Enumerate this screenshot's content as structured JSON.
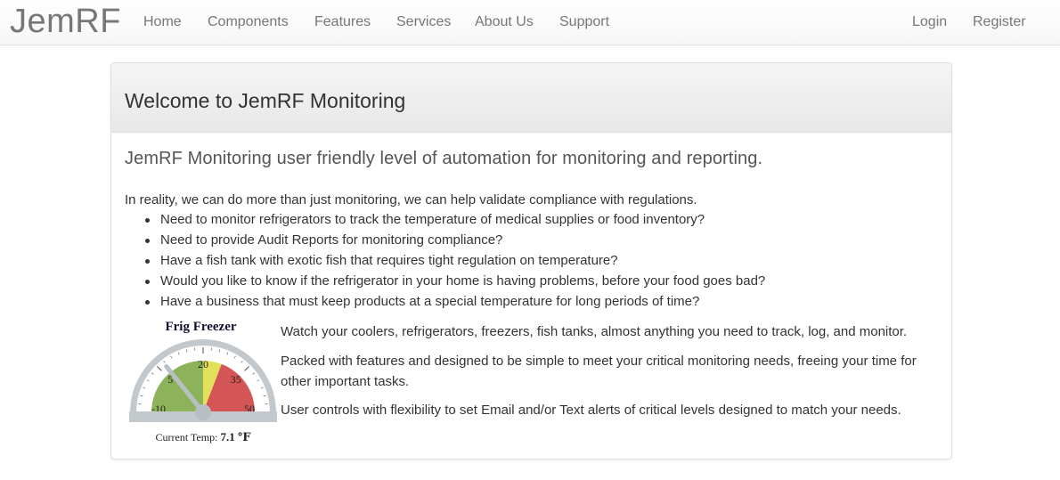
{
  "brand": "JemRF",
  "nav": {
    "left": [
      "Home",
      "Components",
      "Features",
      "Services",
      "About Us",
      "Support"
    ],
    "right": [
      "Login",
      "Register"
    ]
  },
  "panel": {
    "title": "Welcome to JemRF Monitoring",
    "lead": "JemRF Monitoring user friendly level of automation for monitoring and reporting.",
    "intro": "In reality, we can do more than just monitoring, we can help validate compliance with regulations.",
    "bullets": [
      "Need to monitor refrigerators to track the temperature of medical supplies or food inventory?",
      "Need to provide Audit Reports for monitoring compliance?",
      "Have a fish tank with exotic fish that requires tight regulation on temperature?",
      "Would you like to know if the refrigerator in your home is having problems, before your food goes bad?",
      "Have a business that must keep products at a special temperature for long periods of time?"
    ],
    "paragraphs": [
      "Watch your coolers, refrigerators, freezers, fish tanks, almost anything you need to track, log, and monitor.",
      "Packed with features and designed to be simple to meet your critical monitoring needs, freeing your time for other important tasks.",
      "User controls with flexibility to set Email and/or Text alerts of critical levels designed to match your needs."
    ]
  },
  "gauge": {
    "title": "Frig Freezer",
    "caption_label": "Current Temp:",
    "caption_value": "7.1 ℉",
    "min": -10,
    "max": 50,
    "current": 7.1,
    "tick_labels": [
      "-10",
      "5",
      "20",
      "35",
      "50"
    ],
    "bands": [
      {
        "from": -10,
        "to": 20,
        "color": "#8db35a"
      },
      {
        "from": 20,
        "to": 27,
        "color": "#e3e05a"
      },
      {
        "from": 27,
        "to": 50,
        "color": "#d45555"
      }
    ]
  }
}
